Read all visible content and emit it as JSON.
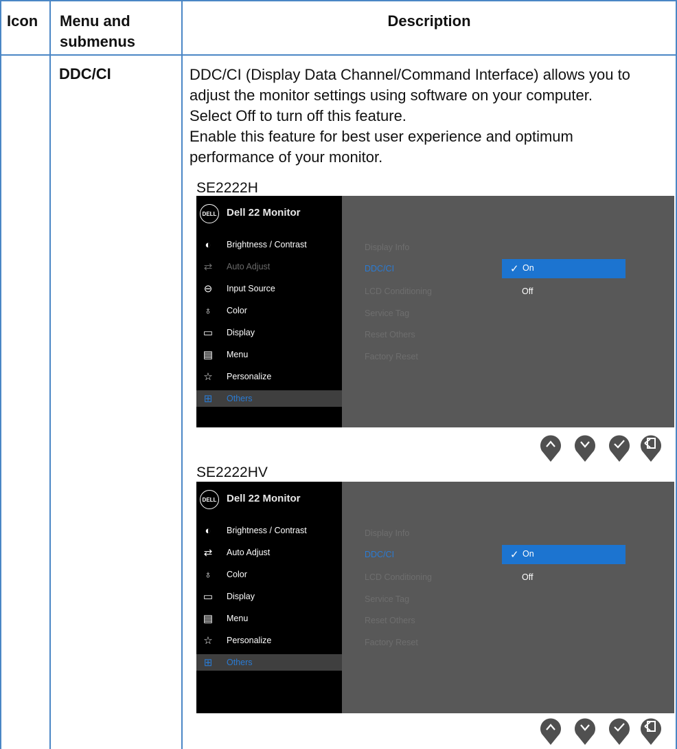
{
  "table": {
    "headers": {
      "icon": "Icon",
      "menu": "Menu and submenus",
      "desc": "Description"
    },
    "row": {
      "menu": "DDC/CI",
      "desc_lines": [
        "DDC/CI (Display Data Channel/Command Interface) allows you to",
        "adjust the monitor settings using software on your computer.",
        "Select Off to turn off this feature.",
        "Enable this feature for best user experience and optimum",
        "performance of your monitor."
      ]
    }
  },
  "screens": [
    {
      "model": "SE2222H",
      "osd": {
        "logo": "DELL",
        "title": "Dell 22 Monitor",
        "menu": [
          {
            "label": "Brightness / Contrast",
            "icon": "brightness-icon",
            "state": "normal"
          },
          {
            "label": "Auto Adjust",
            "icon": "auto-adjust-icon",
            "state": "dim"
          },
          {
            "label": "Input Source",
            "icon": "input-source-icon",
            "state": "normal"
          },
          {
            "label": "Color",
            "icon": "color-icon",
            "state": "normal"
          },
          {
            "label": "Display",
            "icon": "display-icon",
            "state": "normal"
          },
          {
            "label": "Menu",
            "icon": "menu-icon",
            "state": "normal"
          },
          {
            "label": "Personalize",
            "icon": "star-icon",
            "state": "normal"
          },
          {
            "label": "Others",
            "icon": "others-icon",
            "state": "active"
          }
        ],
        "submenu": [
          "Display Info",
          "DDC/CI",
          "LCD Conditioning",
          "Service Tag",
          "Reset Others",
          "Factory Reset"
        ],
        "active_submenu": "DDC/CI",
        "options": {
          "selected": "On",
          "other": "Off"
        }
      }
    },
    {
      "model": "SE2222HV",
      "osd": {
        "logo": "DELL",
        "title": "Dell 22 Monitor",
        "menu": [
          {
            "label": "Brightness / Contrast",
            "icon": "brightness-icon",
            "state": "normal"
          },
          {
            "label": "Auto Adjust",
            "icon": "auto-adjust-icon",
            "state": "normal"
          },
          {
            "label": "Color",
            "icon": "color-icon",
            "state": "normal"
          },
          {
            "label": "Display",
            "icon": "display-icon",
            "state": "normal"
          },
          {
            "label": "Menu",
            "icon": "menu-icon",
            "state": "normal"
          },
          {
            "label": "Personalize",
            "icon": "star-icon",
            "state": "normal"
          },
          {
            "label": "Others",
            "icon": "others-icon",
            "state": "active"
          }
        ],
        "submenu": [
          "Display Info",
          "DDC/CI",
          "LCD Conditioning",
          "Service Tag",
          "Reset Others",
          "Factory Reset"
        ],
        "active_submenu": "DDC/CI",
        "options": {
          "selected": "On",
          "other": "Off"
        }
      }
    }
  ],
  "nav_buttons": [
    "up-button",
    "down-button",
    "confirm-button",
    "back-button"
  ],
  "colors": {
    "border": "#4a86c5",
    "accent": "#1c74d0",
    "osd_bg": "#585858",
    "sidebar_bg": "#000000"
  }
}
